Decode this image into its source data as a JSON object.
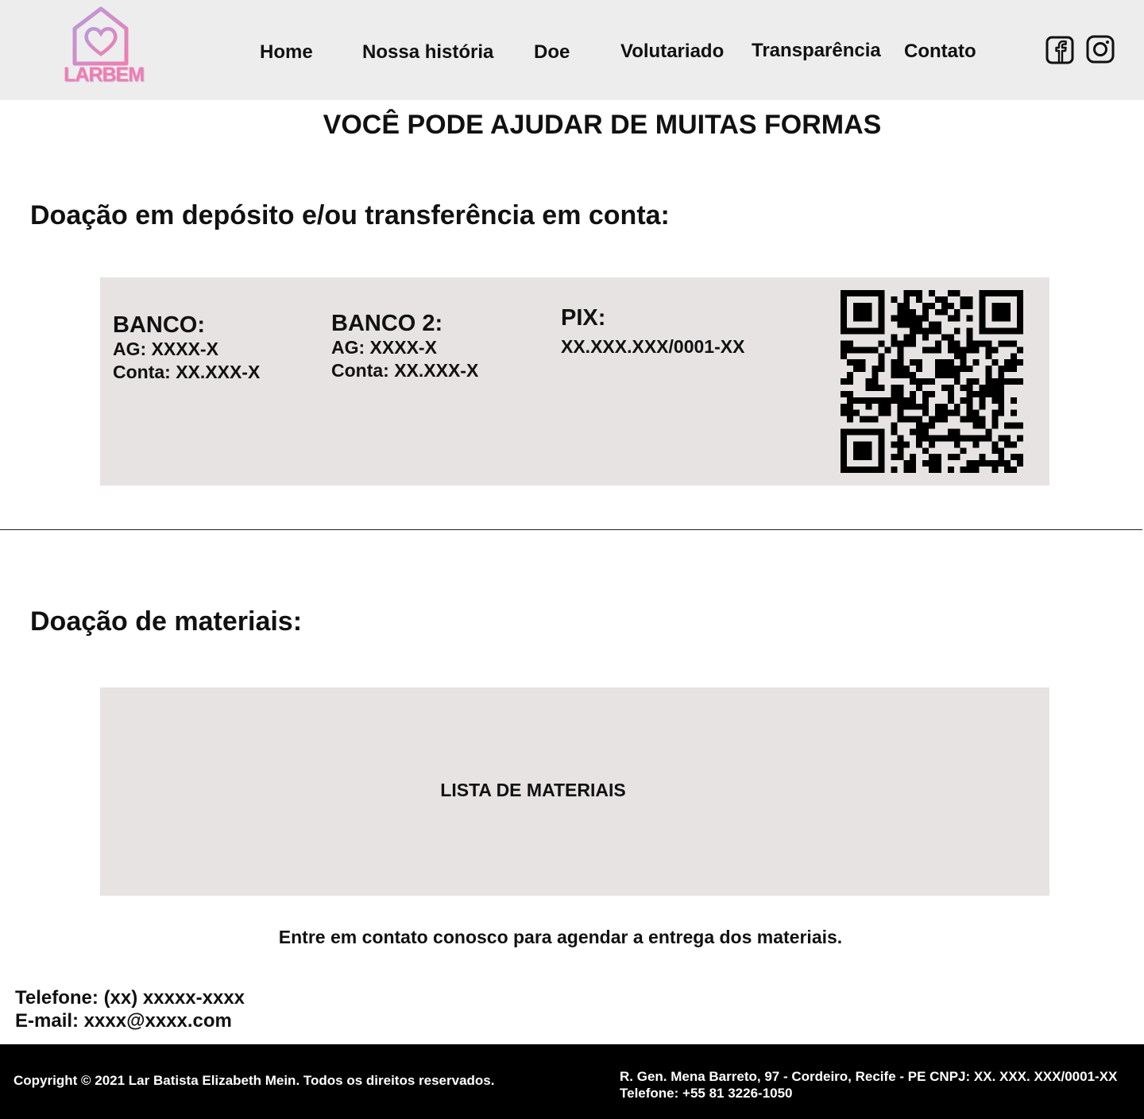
{
  "header": {
    "logo_text": "LARBEM",
    "nav": [
      {
        "label": "Home"
      },
      {
        "label": "Nossa história"
      },
      {
        "label": "Doe"
      },
      {
        "label": "Volutariado"
      },
      {
        "label": "Transparência"
      },
      {
        "label": "Contato"
      }
    ],
    "social": [
      "facebook-icon",
      "instagram-icon"
    ]
  },
  "main": {
    "title": "VOCÊ PODE AJUDAR DE MUITAS FORMAS",
    "deposit_title": "Doação em depósito e/ou transferência em conta:",
    "banks": [
      {
        "title": "BANCO:",
        "agency": "AG: XXXX-X",
        "account": "Conta: XX.XXX-X"
      },
      {
        "title": "BANCO 2:",
        "agency": "AG: XXXX-X",
        "account": "Conta: XX.XXX-X"
      }
    ],
    "pix": {
      "title": "PIX:",
      "key": "XX.XXX.XXX/0001-XX"
    },
    "materials_title": "Doação de materiais:",
    "materials_list_label": "LISTA DE MATERIAIS",
    "contact_note": "Entre em contato conosco para agendar a entrega dos materiais."
  },
  "contact": {
    "phone": "Telefone: (xx) xxxxx-xxxx",
    "email": "E-mail: xxxx@xxxx.com"
  },
  "footer": {
    "copyright": "Copyright © 2021 Lar Batista Elizabeth Mein. Todos os direitos reservados.",
    "address": "R. Gen. Mena Barreto, 97 - Cordeiro, Recife - PE CNPJ: XX. XXX. XXX/0001-XX",
    "phone": "Telefone: +55 81 3226-1050"
  },
  "colors": {
    "header_bg": "#ededed",
    "card_bg": "#e6e3e2",
    "logo_pink": "#f07db0",
    "logo_purple": "#b79bdc",
    "footer_bg": "#000000"
  }
}
